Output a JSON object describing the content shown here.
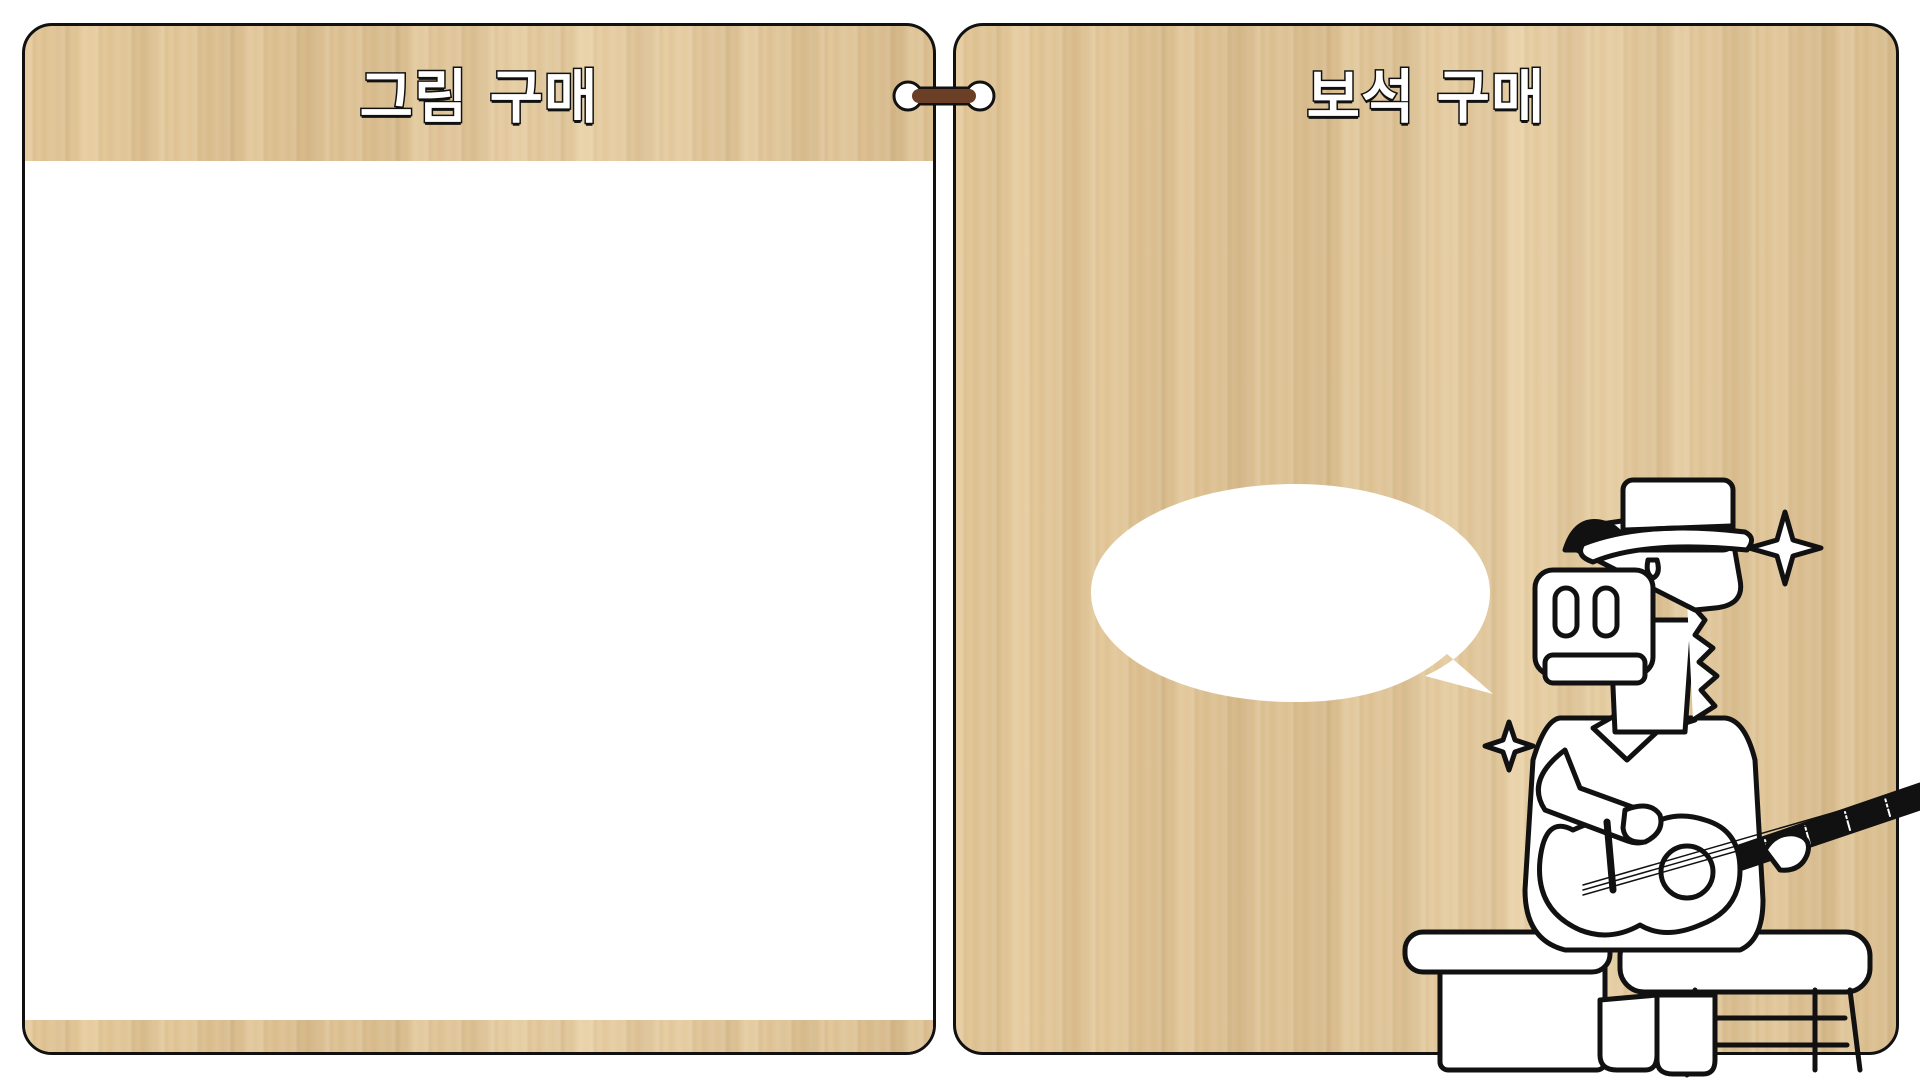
{
  "left_panel": {
    "title": "그림 구매"
  },
  "right_panel": {
    "title": "보석 구매"
  },
  "colors": {
    "wood": "#e2c79a",
    "outline": "#111111",
    "content_bg": "#ffffff",
    "connector_strap": "#6b3e26"
  },
  "icons": {
    "connector": "strap-link-icon",
    "sparkle": "sparkle-icon"
  }
}
